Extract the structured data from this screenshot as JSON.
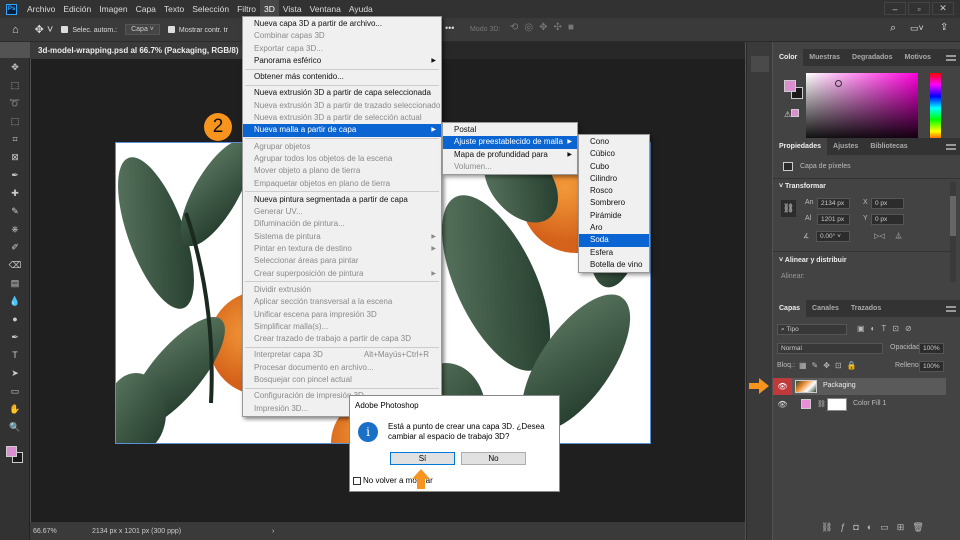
{
  "menubar": {
    "items": [
      "Archivo",
      "Edición",
      "Imagen",
      "Capa",
      "Texto",
      "Selección",
      "Filtro",
      "3D",
      "Vista",
      "Ventana",
      "Ayuda"
    ],
    "active": "3D",
    "logo": "Ps"
  },
  "options": {
    "auto_select_label": "Selec. autom.:",
    "auto_select_value": "Capa",
    "show_transform_label": "Mostrar contr. tr",
    "mode3d_label": "Modo 3D:"
  },
  "document": {
    "tab_title": "3d-model-wrapping.psd al 66.7% (Packaging, RGB/8)",
    "close": "×"
  },
  "status": {
    "zoom": "66.67%",
    "info": "2134 px x 1201 px (300 ppp)",
    "arrow": "›"
  },
  "step_badge": "2",
  "menu3d": [
    {
      "label": "Nueva capa 3D a partir de archivo..."
    },
    {
      "label": "Combinar capas 3D",
      "disabled": true
    },
    {
      "label": "Exportar capa 3D...",
      "disabled": true
    },
    {
      "label": "Panorama esférico",
      "arrow": true
    },
    {
      "sep": true
    },
    {
      "label": "Obtener más contenido..."
    },
    {
      "sep": true
    },
    {
      "label": "Nueva extrusión 3D a partir de capa seleccionada"
    },
    {
      "label": "Nueva extrusión 3D a partir de trazado seleccionado",
      "disabled": true
    },
    {
      "label": "Nueva extrusión 3D a partir de selección actual",
      "disabled": true
    },
    {
      "label": "Nueva malla a partir de capa",
      "arrow": true,
      "highlighted": true
    },
    {
      "sep": true
    },
    {
      "label": "Agrupar objetos",
      "disabled": true
    },
    {
      "label": "Agrupar todos los objetos de la escena",
      "disabled": true
    },
    {
      "label": "Mover objeto a plano de tierra",
      "disabled": true
    },
    {
      "label": "Empaquetar objetos en plano de tierra",
      "disabled": true
    },
    {
      "sep": true
    },
    {
      "label": "Nueva pintura segmentada a partir de capa"
    },
    {
      "label": "Generar UV...",
      "disabled": true
    },
    {
      "label": "Difuminación de pintura...",
      "disabled": true
    },
    {
      "label": "Sistema de pintura",
      "disabled": true,
      "arrow": true
    },
    {
      "label": "Pintar en textura de destino",
      "disabled": true,
      "arrow": true
    },
    {
      "label": "Seleccionar áreas para pintar",
      "disabled": true
    },
    {
      "label": "Crear superposición de pintura",
      "disabled": true,
      "arrow": true
    },
    {
      "sep": true
    },
    {
      "label": "Dividir extrusión",
      "disabled": true
    },
    {
      "label": "Aplicar sección transversal a la escena",
      "disabled": true
    },
    {
      "label": "Unificar escena para impresión 3D",
      "disabled": true
    },
    {
      "label": "Simplificar malla(s)...",
      "disabled": true
    },
    {
      "label": "Crear trazado de trabajo a partir de capa 3D",
      "disabled": true
    },
    {
      "sep": true
    },
    {
      "label": "Interpretar capa 3D",
      "disabled": true,
      "shortcut": "Alt+Mayús+Ctrl+R"
    },
    {
      "label": "Procesar documento en archivo...",
      "disabled": true
    },
    {
      "label": "Bosquejar con pincel actual",
      "disabled": true
    },
    {
      "sep": true
    },
    {
      "label": "Configuración de impresión 3D...",
      "disabled": true
    },
    {
      "label": "Impresión 3D...",
      "disabled": true
    }
  ],
  "submenu_mesh": [
    {
      "label": "Postal"
    },
    {
      "label": "Ajuste preestablecido de malla",
      "arrow": true,
      "highlighted": true
    },
    {
      "label": "Mapa de profundidad para",
      "arrow": true
    },
    {
      "label": "Volumen...",
      "disabled": true
    }
  ],
  "submenu_presets": [
    {
      "label": "Cono"
    },
    {
      "label": "Cúbico"
    },
    {
      "label": "Cubo"
    },
    {
      "label": "Cilindro"
    },
    {
      "label": "Rosco"
    },
    {
      "label": "Sombrero"
    },
    {
      "label": "Pirámide"
    },
    {
      "label": "Aro"
    },
    {
      "label": "Soda",
      "highlighted": true
    },
    {
      "label": "Esfera"
    },
    {
      "label": "Botella de vino"
    }
  ],
  "dialog": {
    "title": "Adobe Photoshop",
    "message1": "Está a punto de crear una capa 3D. ¿Desea",
    "message2": "cambiar al espacio de trabajo 3D?",
    "yes": "Sí",
    "no": "No",
    "dont_show": "No volver a mostrar"
  },
  "color_panel": {
    "tabs": [
      "Color",
      "Muestras",
      "Degradados",
      "Motivos"
    ],
    "foreground": "#d98fd0",
    "background": "#1a1a1a",
    "hue": "#ff00dd"
  },
  "properties": {
    "tabs": [
      "Propiedades",
      "Ajustes",
      "Bibliotecas"
    ],
    "kind": "Capa de píxeles",
    "transform_title": "Transformar",
    "w_label": "An",
    "w": "2134 px",
    "h_label": "Al",
    "h": "1201 px",
    "x_label": "X",
    "x": "0 px",
    "y_label": "Y",
    "y": "0 px",
    "angle": "0.00°",
    "align_title": "Alinear y distribuir",
    "align_label": "Alinear:"
  },
  "layers": {
    "tabs": [
      "Capas",
      "Canales",
      "Trazados"
    ],
    "filter": "Tipo",
    "blend": "Normal",
    "opacity_label": "Opacidad:",
    "opacity": "100%",
    "lock_label": "Bloq.:",
    "fill_label": "Relleno:",
    "fill": "100%",
    "items": [
      {
        "name": "Packaging",
        "selected": true
      },
      {
        "name": "Color Fill 1",
        "color": "#e88fd8"
      }
    ]
  },
  "colors": {
    "accent": "#0a64d2",
    "highlight_orange": "#f7941d",
    "eye_selected": "#c0393b"
  }
}
